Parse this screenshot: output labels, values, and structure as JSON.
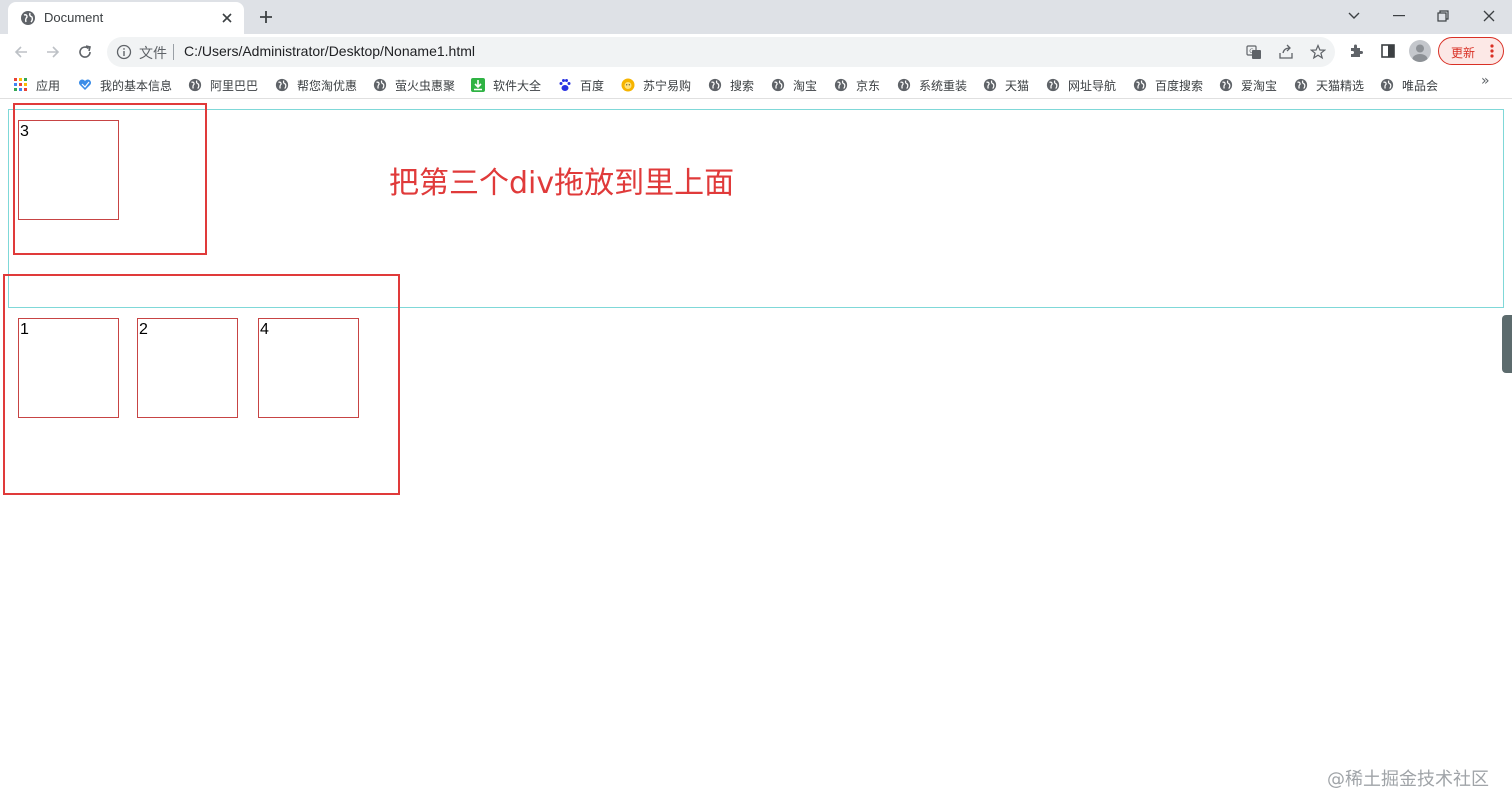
{
  "browser": {
    "tab": {
      "title": "Document"
    },
    "address_bar": {
      "security_label": "文件",
      "url": "C:/Users/Administrator/Desktop/Noname1.html"
    },
    "update_button": {
      "label": "更新"
    },
    "bookmarks": [
      {
        "label": "应用",
        "icon": "apps-grid-icon"
      },
      {
        "label": "我的基本信息",
        "icon": "heart-icon"
      },
      {
        "label": "阿里巴巴",
        "icon": "globe-icon"
      },
      {
        "label": "帮您淘优惠",
        "icon": "globe-icon"
      },
      {
        "label": "萤火虫惠聚",
        "icon": "globe-icon"
      },
      {
        "label": "软件大全",
        "icon": "download-icon"
      },
      {
        "label": "百度",
        "icon": "paw-icon"
      },
      {
        "label": "苏宁易购",
        "icon": "lion-icon"
      },
      {
        "label": "搜索",
        "icon": "globe-icon"
      },
      {
        "label": "淘宝",
        "icon": "globe-icon"
      },
      {
        "label": "京东",
        "icon": "globe-icon"
      },
      {
        "label": "系统重装",
        "icon": "globe-icon"
      },
      {
        "label": "天猫",
        "icon": "globe-icon"
      },
      {
        "label": "网址导航",
        "icon": "globe-icon"
      },
      {
        "label": "百度搜索",
        "icon": "globe-icon"
      },
      {
        "label": "爱淘宝",
        "icon": "globe-icon"
      },
      {
        "label": "天猫精选",
        "icon": "globe-icon"
      },
      {
        "label": "唯品会",
        "icon": "globe-icon"
      }
    ],
    "bookmarks_more": "»"
  },
  "page": {
    "boxes": [
      {
        "num": "3"
      },
      {
        "num": "1"
      },
      {
        "num": "2"
      },
      {
        "num": "4"
      }
    ],
    "annotation": "把第三个div拖放到里上面",
    "watermark": "@稀土掘金技术社区"
  },
  "colors": {
    "annotation_red": "#e03a3a",
    "box_border": "#c74444",
    "dropzone_border": "#7fd8d8",
    "update_red": "#d93025"
  }
}
